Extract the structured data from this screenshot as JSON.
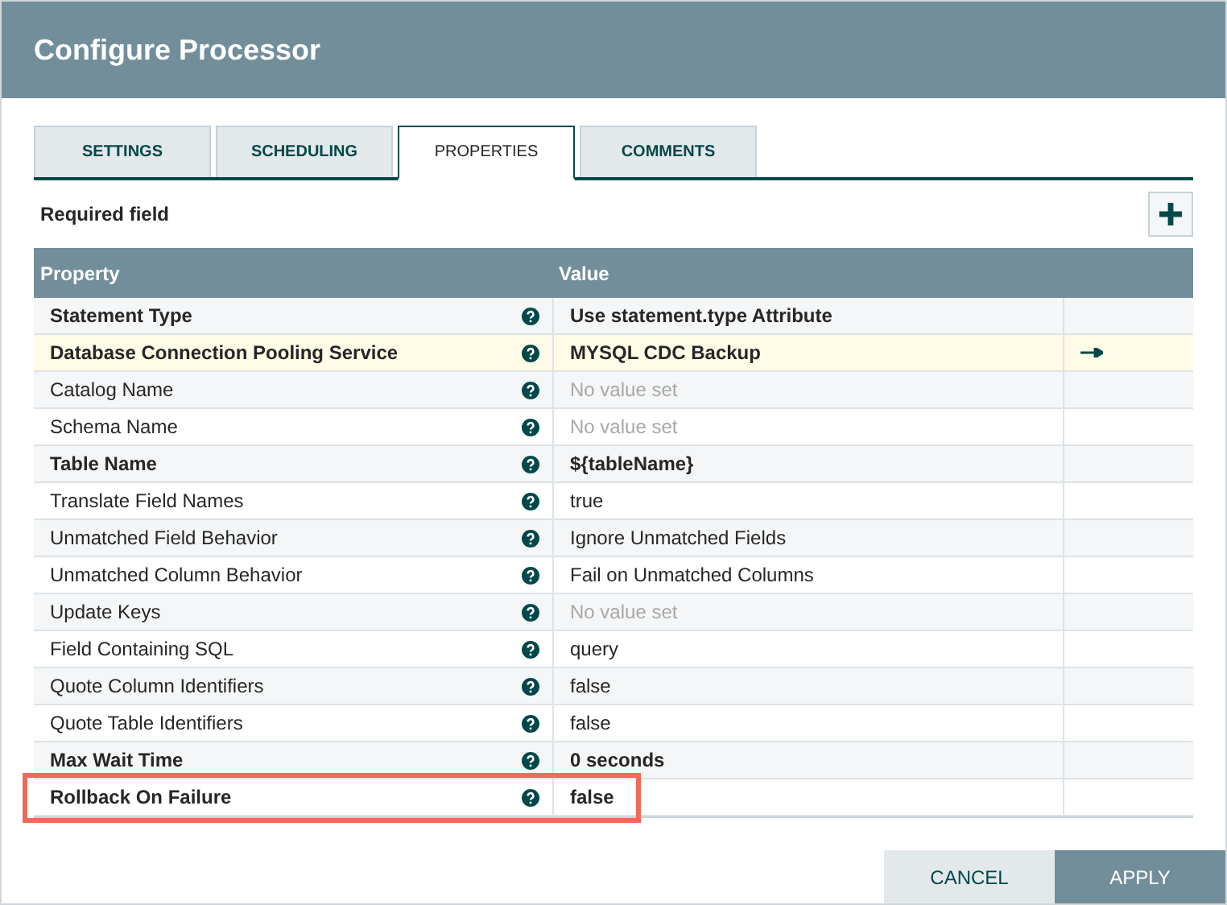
{
  "window": {
    "title": "Configure Processor"
  },
  "tabs": [
    {
      "label": "SETTINGS",
      "selected": false
    },
    {
      "label": "SCHEDULING",
      "selected": false
    },
    {
      "label": "PROPERTIES",
      "selected": true
    },
    {
      "label": "COMMENTS",
      "selected": false
    }
  ],
  "required_note": "Required field",
  "table": {
    "columns": [
      "Property",
      "Value"
    ],
    "rows": [
      {
        "name": "Statement Type",
        "value": "Use statement.type Attribute",
        "required": true,
        "unset": false,
        "selected": false,
        "outlined": false,
        "link": false
      },
      {
        "name": "Database Connection Pooling Service",
        "value": "MYSQL CDC Backup",
        "required": true,
        "unset": false,
        "selected": true,
        "outlined": false,
        "link": true
      },
      {
        "name": "Catalog Name",
        "value": "No value set",
        "required": false,
        "unset": true,
        "selected": false,
        "outlined": false,
        "link": false
      },
      {
        "name": "Schema Name",
        "value": "No value set",
        "required": false,
        "unset": true,
        "selected": false,
        "outlined": false,
        "link": false
      },
      {
        "name": "Table Name",
        "value": "${tableName}",
        "required": true,
        "unset": false,
        "selected": false,
        "outlined": false,
        "link": false
      },
      {
        "name": "Translate Field Names",
        "value": "true",
        "required": false,
        "unset": false,
        "selected": false,
        "outlined": false,
        "link": false
      },
      {
        "name": "Unmatched Field Behavior",
        "value": "Ignore Unmatched Fields",
        "required": false,
        "unset": false,
        "selected": false,
        "outlined": false,
        "link": false
      },
      {
        "name": "Unmatched Column Behavior",
        "value": "Fail on Unmatched Columns",
        "required": false,
        "unset": false,
        "selected": false,
        "outlined": false,
        "link": false
      },
      {
        "name": "Update Keys",
        "value": "No value set",
        "required": false,
        "unset": true,
        "selected": false,
        "outlined": false,
        "link": false
      },
      {
        "name": "Field Containing SQL",
        "value": "query",
        "required": false,
        "unset": false,
        "selected": false,
        "outlined": false,
        "link": false
      },
      {
        "name": "Quote Column Identifiers",
        "value": "false",
        "required": false,
        "unset": false,
        "selected": false,
        "outlined": false,
        "link": false
      },
      {
        "name": "Quote Table Identifiers",
        "value": "false",
        "required": false,
        "unset": false,
        "selected": false,
        "outlined": false,
        "link": false
      },
      {
        "name": "Max Wait Time",
        "value": "0 seconds",
        "required": true,
        "unset": false,
        "selected": false,
        "outlined": false,
        "link": false
      },
      {
        "name": "Rollback On Failure",
        "value": "false",
        "required": true,
        "unset": false,
        "selected": false,
        "outlined": true,
        "link": false
      }
    ]
  },
  "buttons": [
    {
      "label": "CANCEL",
      "kind": "secondary"
    },
    {
      "label": "APPLY",
      "kind": "primary"
    }
  ]
}
